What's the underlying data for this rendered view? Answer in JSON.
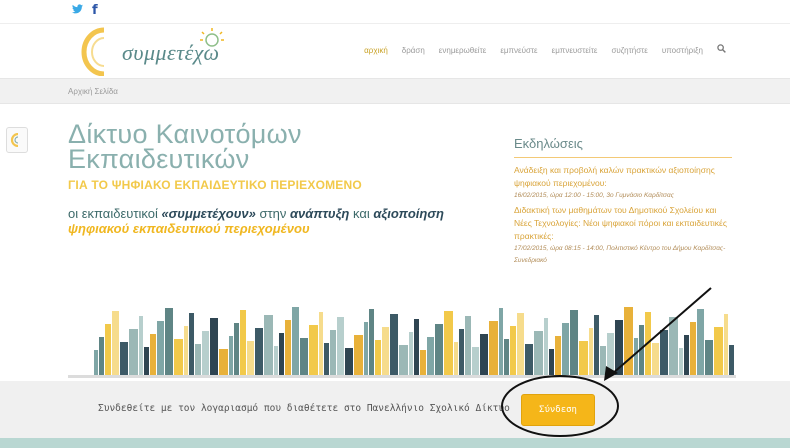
{
  "social": {
    "twitter_icon": "t",
    "facebook_icon": "f"
  },
  "header": {
    "logo_text": "συμμετέχω",
    "nav": [
      {
        "label": "αρχική",
        "active": true
      },
      {
        "label": "δράση",
        "active": false
      },
      {
        "label": "ενημερωθείτε",
        "active": false
      },
      {
        "label": "εμπνεύστε",
        "active": false
      },
      {
        "label": "εμπνευστείτε",
        "active": false
      },
      {
        "label": "συζητήστε",
        "active": false
      },
      {
        "label": "υποστήριξη",
        "active": false
      }
    ],
    "search_icon": "magnifier"
  },
  "breadcrumb": {
    "label": "Αρχική Σελίδα"
  },
  "hero": {
    "title_line1": "Δίκτυο Καινοτόμων",
    "title_line2": "Εκπαιδευτικών",
    "subtitle": "ΓΙΑ ΤΟ ΨΗΦΙΑΚΟ ΕΚΠΑΙΔΕΥΤΙΚΟ ΠΕΡΙΕΧΟΜΕΝΟ",
    "tagline": {
      "part1": "οι εκπαιδευτικοί ",
      "kw1": "«συμμετέχουν»",
      "part2": " στην ",
      "kw2": "ανάπτυξη",
      "part3": " και ",
      "kw3": "αξιοποίηση",
      "kw4": "ψηφιακού εκπαιδευτικού περιεχομένου"
    }
  },
  "events": {
    "title": "Εκδηλώσεις",
    "items": [
      {
        "text": "Ανάδειξη και προβολή καλών πρακτικών αξιοποίησης ψηφιακού περιεχομένου:",
        "date": "16/02/2015, ώρα 12:00 - 15:00, 3ο Γυμνάσιο Καρδίτσας"
      },
      {
        "text": "Διδακτική των μαθημάτων του Δημοτικού Σχολείου και Νέες Τεχνολογίες: Νέοι ψηφιακοί πόροι και εκπαιδευτικές πρακτικές:",
        "date": "17/02/2015, ώρα 08:15 - 14:00, Πολιτιστικό Κέντρο του Δήμου Καρδίτσας-Συνεδριακό"
      }
    ]
  },
  "login": {
    "text": "Συνδεθείτε με τον λογαριασμό που διαθέτετε στο Πανελλήνιο Σχολικό Δίκτυο",
    "button_label": "Σύνδεση"
  },
  "colors": {
    "accent_yellow": "#f5b619",
    "teal": "#8ab0ae",
    "nav_active": "#c9a227"
  }
}
